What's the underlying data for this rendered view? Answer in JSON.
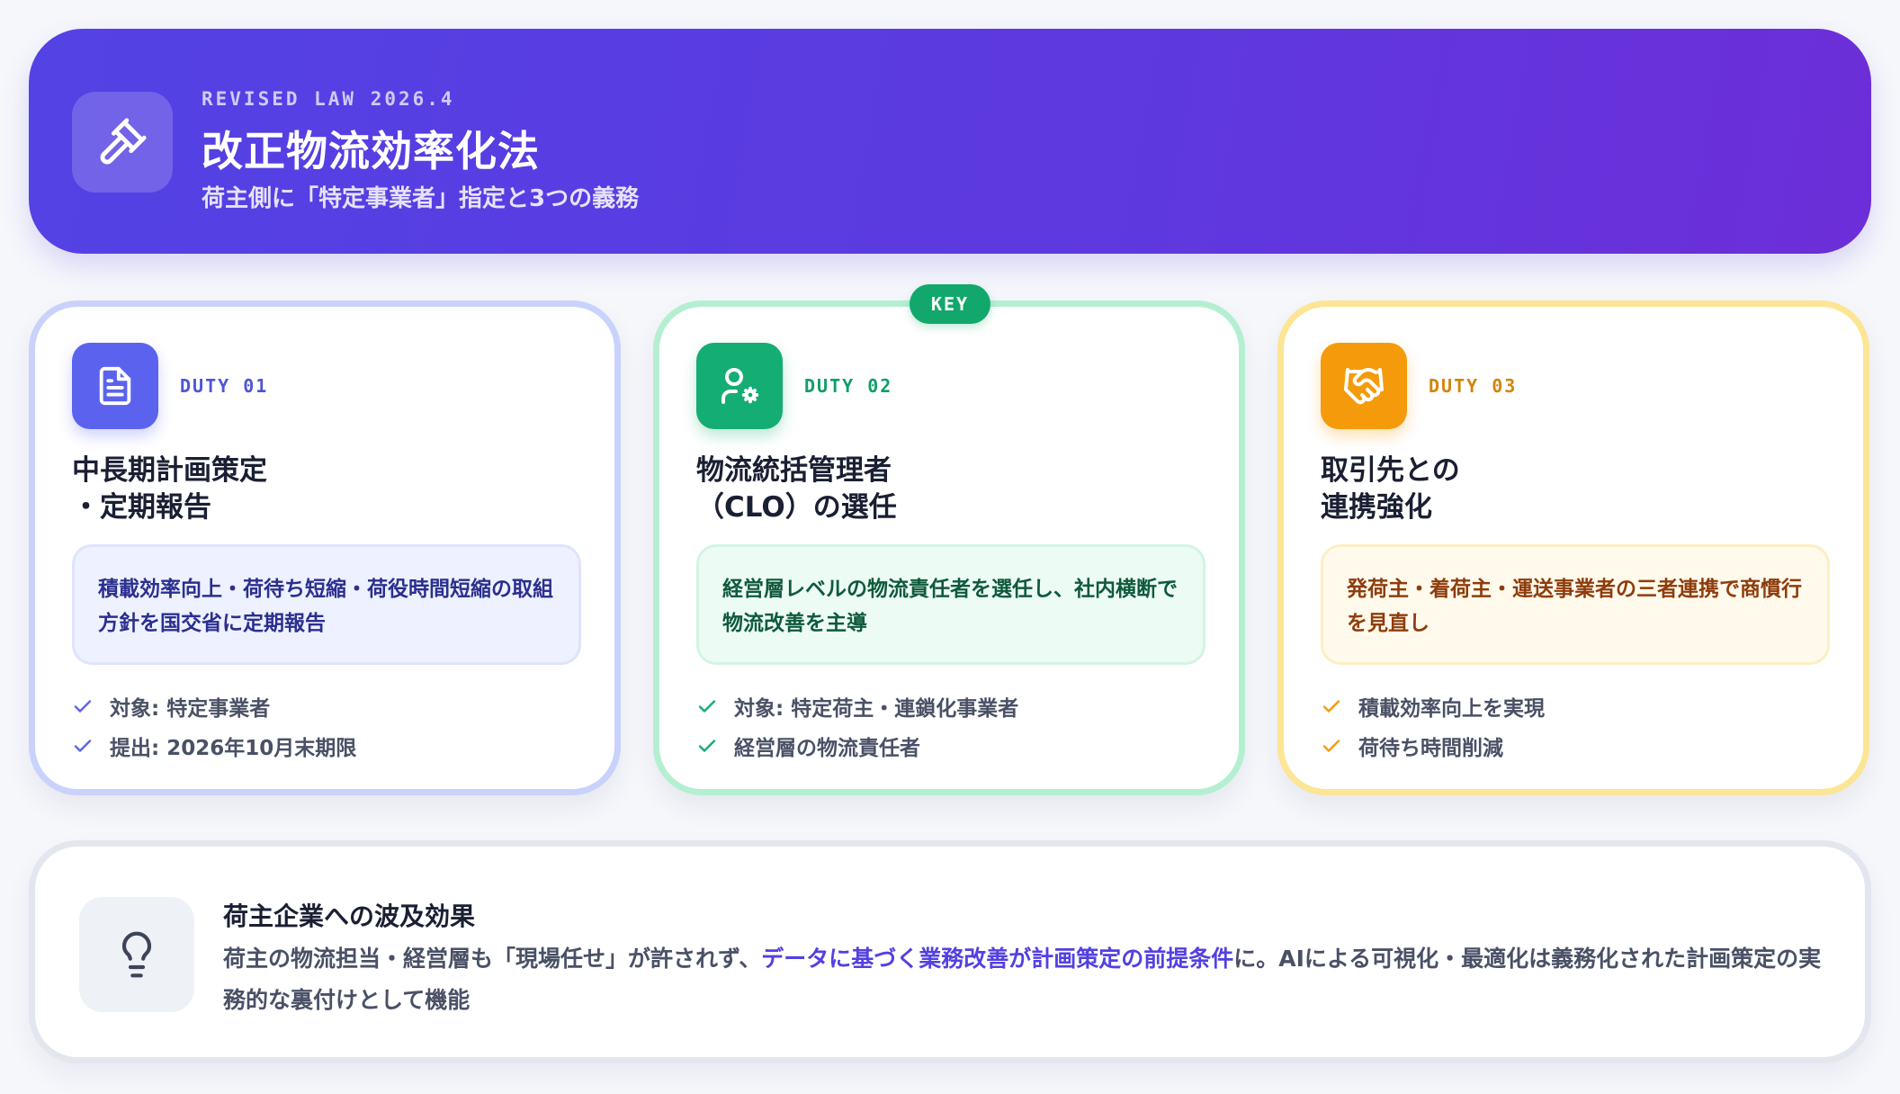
{
  "header": {
    "icon": "gavel-icon",
    "eyebrow": "REVISED LAW 2026.4",
    "title": "改正物流効率化法",
    "subtitle": "荷主側に「特定事業者」指定と3つの義務"
  },
  "key_badge": "KEY",
  "duties": [
    {
      "icon": "document-icon",
      "label": "DUTY 01",
      "title_lines": [
        "中長期計画策定",
        "・定期報告"
      ],
      "description": "積載効率向上・荷待ち短縮・荷役時間短縮の取組方針を国交省に定期報告",
      "points": [
        "対象: 特定事業者",
        "提出: 2026年10月末期限"
      ],
      "accent": "#5b63ee"
    },
    {
      "icon": "user-gear-icon",
      "label": "DUTY 02",
      "title_lines": [
        "物流統括管理者",
        "（CLO）の選任"
      ],
      "description": "経営層レベルの物流責任者を選任し、社内横断で物流改善を主導",
      "points": [
        "対象: 特定荷主・連鎖化事業者",
        "経営層の物流責任者"
      ],
      "accent": "#14ad74"
    },
    {
      "icon": "handshake-icon",
      "label": "DUTY 03",
      "title_lines": [
        "取引先との",
        "連携強化"
      ],
      "description": "発荷主・着荷主・運送事業者の三者連携で商慣行を見直し",
      "points": [
        "積載効率向上を実現",
        "荷待ち時間削減"
      ],
      "accent": "#f59b0b"
    }
  ],
  "impact": {
    "icon": "lightbulb-icon",
    "title": "荷主企業への波及効果",
    "body_before": "荷主の物流担当・経営層も「現場任せ」が許されず、",
    "body_highlight": "データに基づく業務改善が計画策定の前提条件",
    "body_after": "に。AIによる可視化・最適化は義務化された計画策定の実務的な裏付けとして機能"
  }
}
